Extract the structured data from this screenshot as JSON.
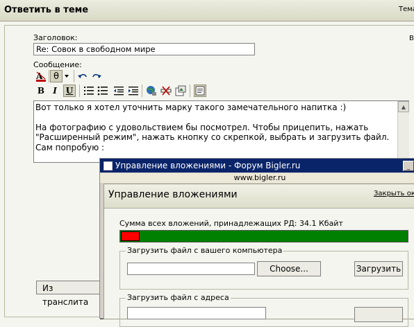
{
  "header": {
    "title": "Ответить в теме",
    "right_text": "Тема"
  },
  "form": {
    "subject_label": "Заголовок:",
    "subject_value": "Re:  Совок в свободном мире",
    "message_label": "Сообщение:",
    "message_text": "Вот только я хотел уточнить марку такого замечательного напитка :)\n\nНа фотографию с удовольствием бы посмотрел. Чтобы прицепить, нажать \"Расширенный режим\", нажать кнопку со скрепкой, выбрать и загрузить файл. Сам попробую :",
    "translit_button": "Из транслита",
    "right_edge_text": "В"
  },
  "toolbar": {
    "row1": [
      "font-color-icon",
      "theta-icon",
      "dropdown-arrow-icon",
      "undo-icon",
      "redo-icon"
    ],
    "bold": "B",
    "italic": "I",
    "underline": "U",
    "theta": "θ"
  },
  "popup": {
    "window_title": "Управление вложениями - Форум Bigler.ru",
    "url": "www.bigler.ru",
    "heading": "Управление вложениями",
    "close_link": "Закрыть окно",
    "sum_label": "Сумма всех вложений, принадлежащих РД: 34.1 Кбайт",
    "usage_fraction": 0.06,
    "upload_local_legend": "Загрузить файл с вашего компьютера",
    "choose_button": "Choose...",
    "upload_button": "Загрузить",
    "upload_url_legend": "Загрузить файл с адреса"
  },
  "colors": {
    "bar_used": "#ff0000",
    "bar_free": "#008000",
    "titlebar": "#0a246a"
  }
}
